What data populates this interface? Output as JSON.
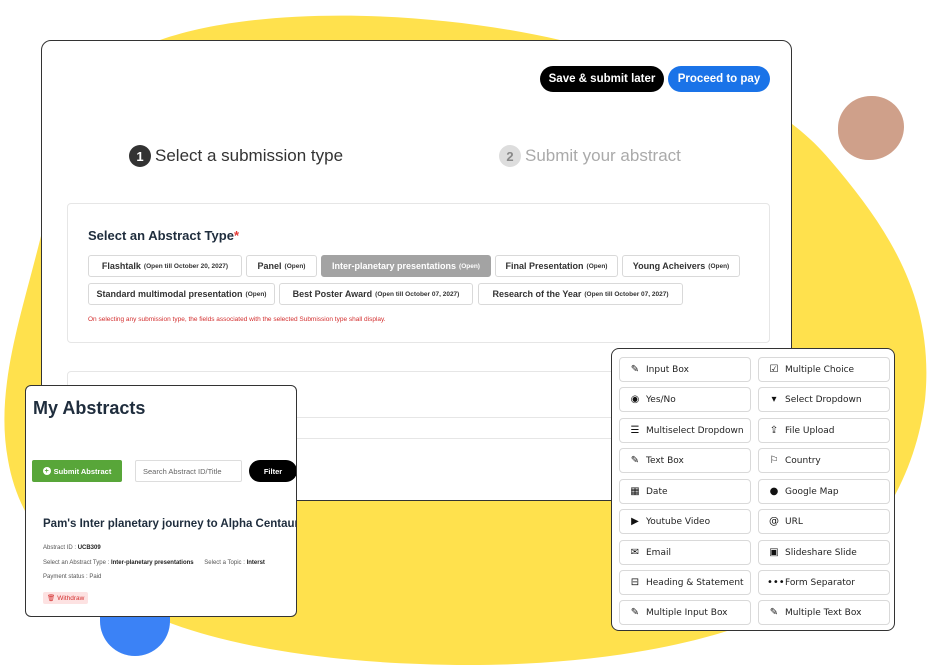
{
  "header": {
    "save_label": "Save & submit later",
    "pay_label": "Proceed to pay"
  },
  "steps": [
    {
      "num": "1",
      "label": "Select a submission type"
    },
    {
      "num": "2",
      "label": "Submit your abstract"
    }
  ],
  "abstract_type": {
    "heading": "Select an Abstract Type",
    "required_mark": "*",
    "options": [
      {
        "label": "Flashtalk",
        "status": "(Open till October 20, 2027)"
      },
      {
        "label": "Panel",
        "status": "(Open)"
      },
      {
        "label": "Inter-planetary presentations",
        "status": "(Open)"
      },
      {
        "label": "Final Presentation",
        "status": "(Open)"
      },
      {
        "label": "Young Acheivers",
        "status": "(Open)"
      },
      {
        "label": "Standard multimodal presentation",
        "status": "(Open)"
      },
      {
        "label": "Best Poster Award",
        "status": "(Open till October 07, 2027)"
      },
      {
        "label": "Research of the Year",
        "status": "(Open till October 07, 2027)"
      }
    ],
    "selected": "Inter-planetary presentations",
    "note": "On selecting any submission type, the fields associated with the selected Submission type shall display."
  },
  "my_abstracts": {
    "title": "My Abstracts",
    "submit_label": "Submit Abstract",
    "search_placeholder": "Search Abstract ID/Title",
    "filter_label": "Filter",
    "item": {
      "title": "Pam's Inter planetary journey to Alpha Centauri",
      "id_label": "Abstract ID :",
      "id_value": "UCB309",
      "type_label": "Select an Abstract Type :",
      "type_value": "Inter-planetary presentations",
      "topic_label": "Select a Topic :",
      "topic_value": "Interst",
      "payment_label": "Payment status :",
      "payment_value": "Paid",
      "withdraw_label": "Withdraw"
    }
  },
  "field_types": [
    {
      "label": "Input Box",
      "icon": "edit-icon"
    },
    {
      "label": "Multiple Choice",
      "icon": "checkbox-icon"
    },
    {
      "label": "Yes/No",
      "icon": "radio-icon"
    },
    {
      "label": "Select Dropdown",
      "icon": "caret-down-icon"
    },
    {
      "label": "Multiselect Dropdown",
      "icon": "list-icon"
    },
    {
      "label": "File Upload",
      "icon": "upload-icon"
    },
    {
      "label": "Text Box",
      "icon": "edit-icon"
    },
    {
      "label": "Country",
      "icon": "flag-icon"
    },
    {
      "label": "Date",
      "icon": "calendar-icon"
    },
    {
      "label": "Google Map",
      "icon": "globe-icon"
    },
    {
      "label": "Youtube Video",
      "icon": "youtube-icon"
    },
    {
      "label": "URL",
      "icon": "at-icon"
    },
    {
      "label": "Email",
      "icon": "envelope-icon"
    },
    {
      "label": "Slideshare Slide",
      "icon": "slideshare-icon"
    },
    {
      "label": "Heading & Statement",
      "icon": "minus-square-icon"
    },
    {
      "label": "Form Separator",
      "icon": "ellipsis-icon"
    },
    {
      "label": "Multiple Input Box",
      "icon": "edit-icon"
    },
    {
      "label": "Multiple Text Box",
      "icon": "edit-icon"
    }
  ],
  "colors": {
    "primary": "#1a73e8",
    "success": "#58a639",
    "background_blob": "#ffe14d",
    "accent_blob": "#cfa08a",
    "blue_blob": "#3b82f6",
    "required": "#e53935"
  }
}
